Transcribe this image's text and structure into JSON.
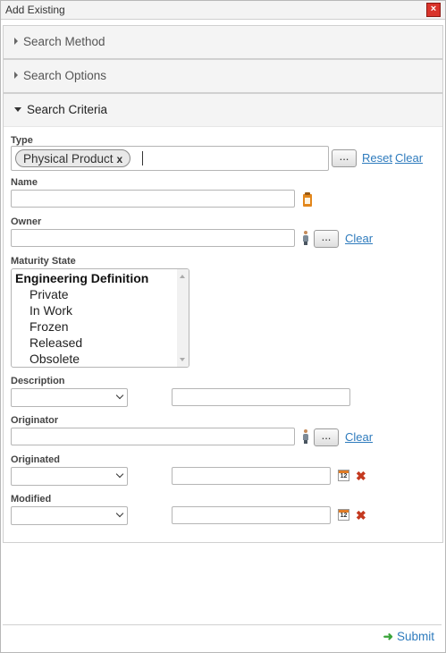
{
  "window": {
    "title": "Add Existing"
  },
  "sections": {
    "search_method": "Search Method",
    "search_options": "Search Options",
    "search_criteria": "Search Criteria"
  },
  "type": {
    "label": "Type",
    "chip": "Physical Product",
    "chip_remove": "x",
    "browse": "...",
    "reset": "Reset",
    "clear": "Clear"
  },
  "name": {
    "label": "Name",
    "value": ""
  },
  "owner": {
    "label": "Owner",
    "value": "",
    "browse": "...",
    "clear": "Clear"
  },
  "maturity": {
    "label": "Maturity State",
    "group": "Engineering Definition",
    "options": [
      "Private",
      "In Work",
      "Frozen",
      "Released",
      "Obsolete"
    ]
  },
  "description": {
    "label": "Description",
    "operator": "",
    "value": ""
  },
  "originator": {
    "label": "Originator",
    "value": "",
    "browse": "...",
    "clear": "Clear"
  },
  "originated": {
    "label": "Originated",
    "operator": "",
    "value": "",
    "calendar_day": "12"
  },
  "modified": {
    "label": "Modified",
    "operator": "",
    "value": "",
    "calendar_day": "12"
  },
  "footer": {
    "submit": "Submit"
  },
  "icons": {
    "close": "close-icon",
    "clipboard": "clipboard-icon",
    "person": "person-icon",
    "calendar": "calendar-icon",
    "clear_date": "x-icon",
    "submit": "arrow-right-icon"
  },
  "colors": {
    "link": "#2e7bbd",
    "close": "#d9342b",
    "clear_x": "#c4391f",
    "submit_arrow": "#3aa43a"
  }
}
